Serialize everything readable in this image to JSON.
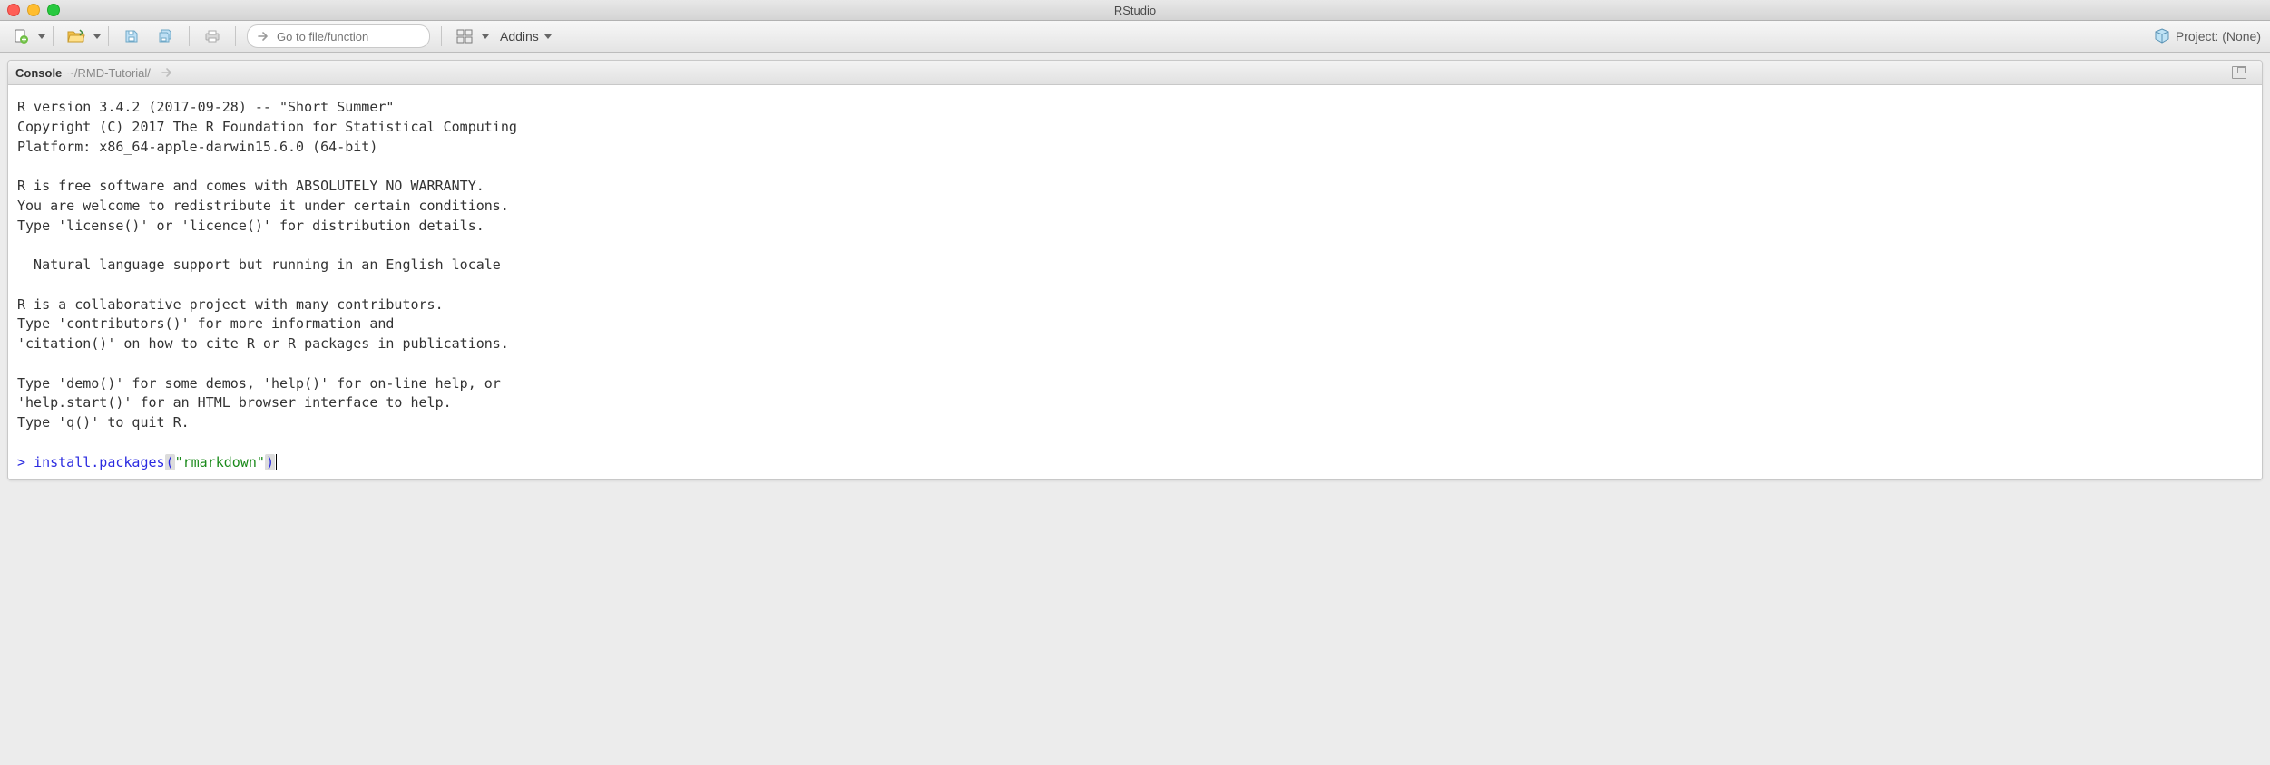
{
  "window": {
    "title": "RStudio"
  },
  "toolbar": {
    "goto_placeholder": "Go to file/function",
    "addins_label": "Addins",
    "project_label": "Project: (None)"
  },
  "console": {
    "tab_label": "Console",
    "working_dir": "~/RMD-Tutorial/",
    "startup_text": "R version 3.4.2 (2017-09-28) -- \"Short Summer\"\nCopyright (C) 2017 The R Foundation for Statistical Computing\nPlatform: x86_64-apple-darwin15.6.0 (64-bit)\n\nR is free software and comes with ABSOLUTELY NO WARRANTY.\nYou are welcome to redistribute it under certain conditions.\nType 'license()' or 'licence()' for distribution details.\n\n  Natural language support but running in an English locale\n\nR is a collaborative project with many contributors.\nType 'contributors()' for more information and\n'citation()' on how to cite R or R packages in publications.\n\nType 'demo()' for some demos, 'help()' for on-line help, or\n'help.start()' for an HTML browser interface to help.\nType 'q()' to quit R.\n",
    "prompt_char": ">",
    "input_func": "install.packages",
    "input_open": "(",
    "input_arg": "\"rmarkdown\"",
    "input_close": ")"
  }
}
